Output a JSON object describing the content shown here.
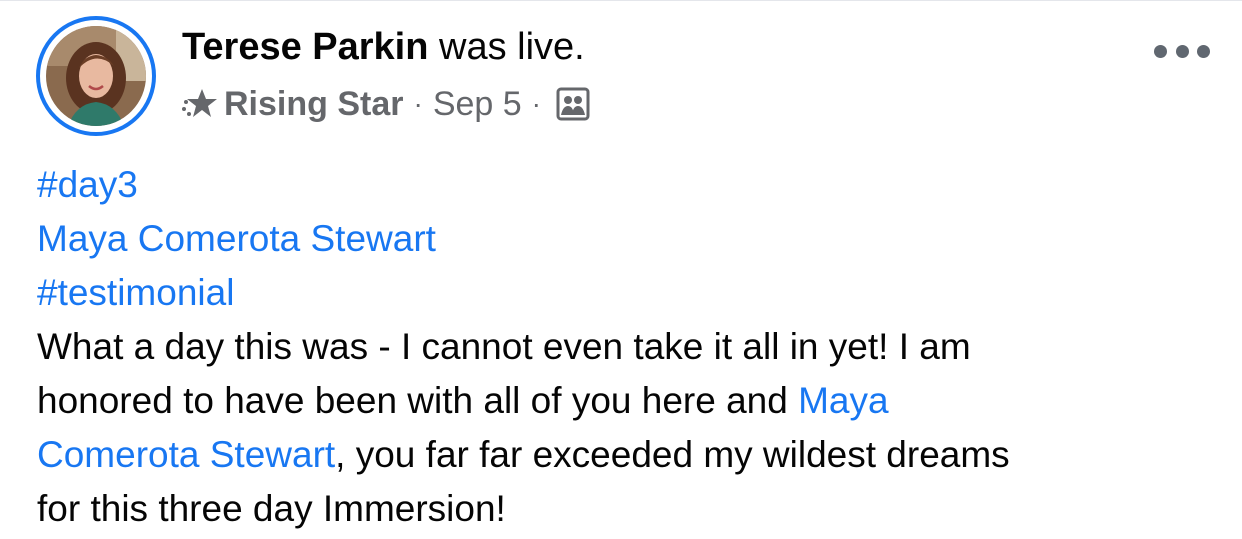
{
  "post": {
    "author": {
      "name": "Terese Parkin",
      "action": " was live."
    },
    "badge": {
      "icon": "rising-star-icon",
      "label": "Rising Star"
    },
    "separator": "·",
    "date": "Sep 5",
    "audience_icon": "custom-audience-icon",
    "more_icon": "more-options-icon",
    "body": {
      "hashtag_1": "#day3",
      "mention_1": "Maya Comerota Stewart",
      "hashtag_2": "#testimonial",
      "line_1": "What a day this was - I cannot even take it all in yet! I am",
      "line_2_text": "honored to have been with all of you here and ",
      "line_2_mention": "Maya",
      "line_3_mention": "Comerota Stewart",
      "line_3_text": ", you far far exceeded my wildest dreams",
      "line_4": "for this three day Immersion!"
    }
  },
  "colors": {
    "link": "#1877f2",
    "text": "#050505",
    "secondary": "#65676b",
    "avatar_ring": "#1877f2"
  }
}
